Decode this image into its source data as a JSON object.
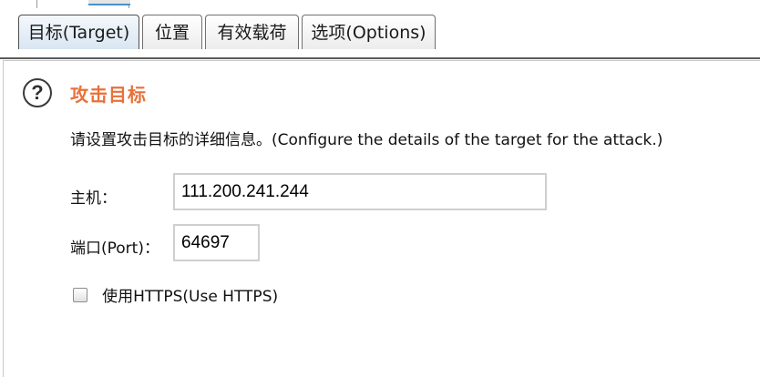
{
  "tabs": [
    {
      "label": "目标(Target)",
      "active": true
    },
    {
      "label": "位置",
      "active": false
    },
    {
      "label": "有效载荷",
      "active": false
    },
    {
      "label": "选项(Options)",
      "active": false
    }
  ],
  "section": {
    "help_icon_glyph": "?",
    "title": "攻击目标",
    "description": "请设置攻击目标的详细信息。(Configure the details of the target for the attack.)"
  },
  "form": {
    "host_label": "主机：",
    "host_value": "111.200.241.244",
    "port_label": "端口(Port)：",
    "port_value": "64697",
    "https_label": "使用HTTPS(Use HTTPS)",
    "https_checked": false
  },
  "colors": {
    "section_title": "#e8713a",
    "tab_active_bg": "#d9e6f2"
  },
  "icons": {
    "help": "help-circle-icon",
    "checkbox": "checkbox-unchecked"
  }
}
